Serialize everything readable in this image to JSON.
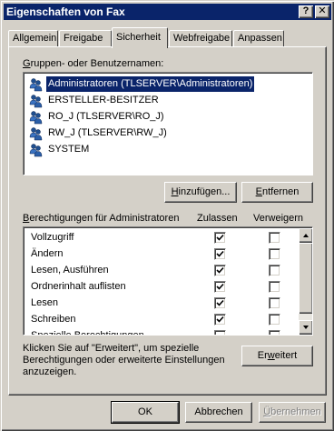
{
  "window": {
    "title": "Eigenschaften von Fax",
    "help_glyph": "?",
    "close_glyph": "✕"
  },
  "tabs": [
    {
      "label": "Allgemein"
    },
    {
      "label": "Freigabe"
    },
    {
      "label": "Sicherheit",
      "active": true
    },
    {
      "label": "Webfreigabe"
    },
    {
      "label": "Anpassen"
    }
  ],
  "users_section": {
    "label_prefix": "G",
    "label_rest": "ruppen- oder Benutzernamen:",
    "users": [
      {
        "name": "Administratoren (TLSERVER\\Administratoren)",
        "icon": "users-group-icon",
        "selected": true
      },
      {
        "name": "ERSTELLER-BESITZER",
        "icon": "users-group-icon"
      },
      {
        "name": "RO_J (TLSERVER\\RO_J)",
        "icon": "users-group-icon"
      },
      {
        "name": "RW_J (TLSERVER\\RW_J)",
        "icon": "users-group-icon"
      },
      {
        "name": "SYSTEM",
        "icon": "users-group-icon"
      }
    ],
    "add_button": {
      "pre": "",
      "hot": "H",
      "post": "inzufügen..."
    },
    "remove_button": {
      "pre": "",
      "hot": "E",
      "post": "ntfernen"
    }
  },
  "permissions_section": {
    "label_prefix": "B",
    "label_rest": "erechtigungen für Administratoren",
    "allow_header": "Zulassen",
    "deny_header": "Verweigern",
    "items": [
      {
        "name": "Vollzugriff",
        "allow": true,
        "deny": false
      },
      {
        "name": "Ändern",
        "allow": true,
        "deny": false
      },
      {
        "name": "Lesen, Ausführen",
        "allow": true,
        "deny": false
      },
      {
        "name": "Ordnerinhalt auflisten",
        "allow": true,
        "deny": false
      },
      {
        "name": "Lesen",
        "allow": true,
        "deny": false
      },
      {
        "name": "Schreiben",
        "allow": true,
        "deny": false
      },
      {
        "name": "Spezielle Berechtigungen",
        "allow": false,
        "deny": false
      }
    ]
  },
  "advanced": {
    "hint_line1": "Klicken Sie auf \"Erweitert\", um spezielle",
    "hint_line2": "Berechtigungen oder erweiterte Einstellungen",
    "hint_line3": "anzuzeigen.",
    "button": {
      "pre": "Er",
      "hot": "w",
      "post": "eitert"
    }
  },
  "footer": {
    "ok": "OK",
    "cancel": "Abbrechen",
    "apply": {
      "pre": "",
      "hot": "Ü",
      "post": "bernehmen"
    }
  },
  "colors": {
    "title_bg": "#0a246a",
    "face": "#d4d0c8",
    "selection": "#0a246a"
  }
}
